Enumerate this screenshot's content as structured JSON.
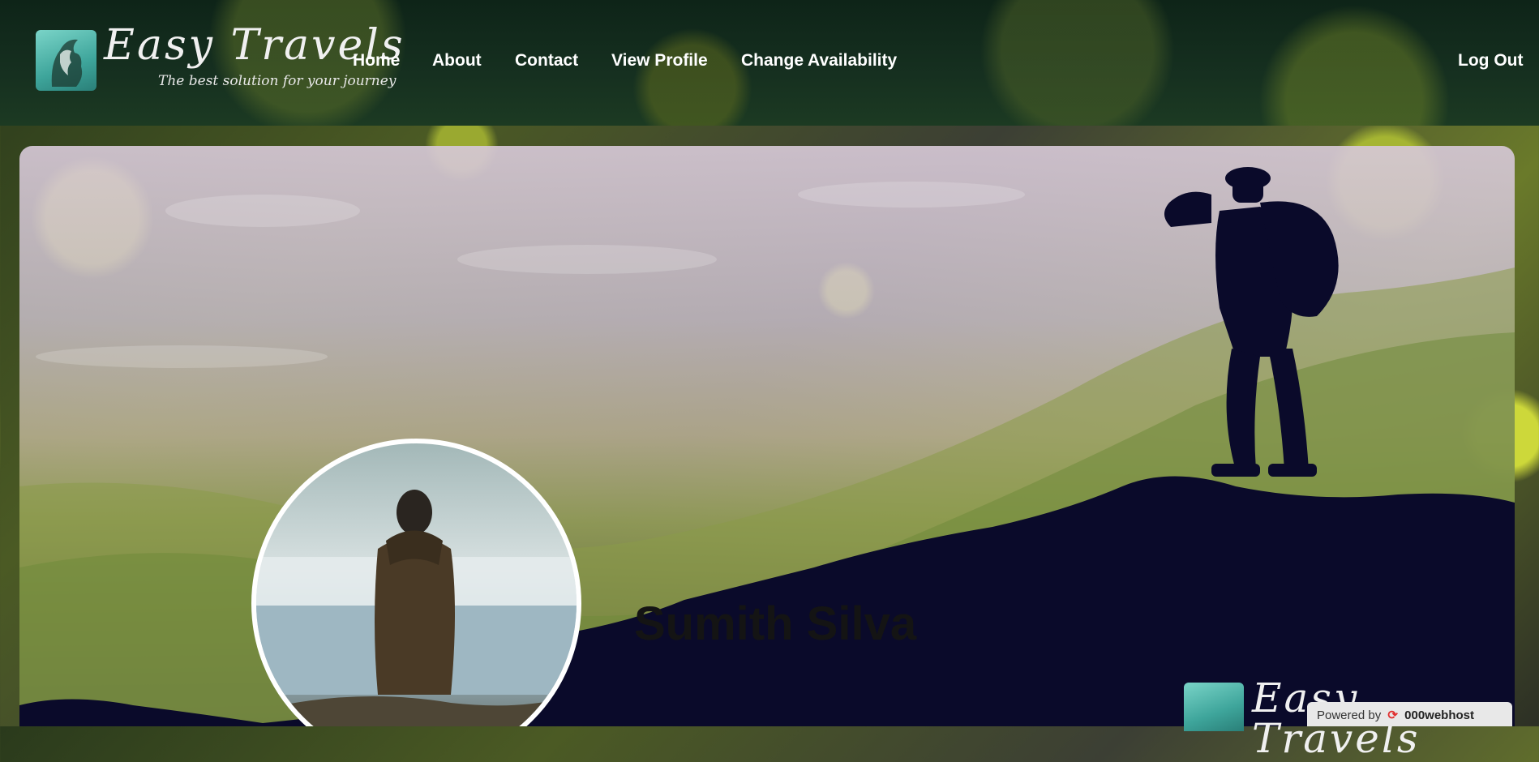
{
  "header": {
    "brand_name": "Easy Travels",
    "tagline": "The best solution for your journey",
    "logo_icon": "lion-logo-icon"
  },
  "nav": {
    "items": [
      {
        "label": "Home"
      },
      {
        "label": "About"
      },
      {
        "label": "Contact"
      },
      {
        "label": "View Profile"
      },
      {
        "label": "Change Availability"
      }
    ],
    "logout_label": "Log Out"
  },
  "profile": {
    "name": "Sumith Silva",
    "avatar_icon": "profile-photo"
  },
  "footer": {
    "brand_name": "Easy Travels",
    "powered_by": "Powered by",
    "host_name": "000webhost"
  },
  "colors": {
    "header_bg": "#163020",
    "nav_text": "#ffffff",
    "name_text": "#141414",
    "silhouette": "#0a0a2a",
    "logo_bg": "#3ea59b"
  }
}
